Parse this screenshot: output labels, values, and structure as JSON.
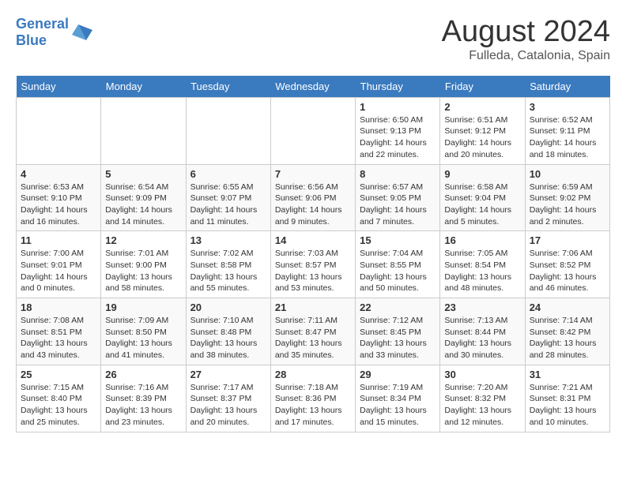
{
  "logo": {
    "line1": "General",
    "line2": "Blue"
  },
  "title": "August 2024",
  "subtitle": "Fulleda, Catalonia, Spain",
  "weekdays": [
    "Sunday",
    "Monday",
    "Tuesday",
    "Wednesday",
    "Thursday",
    "Friday",
    "Saturday"
  ],
  "weeks": [
    [
      {
        "day": "",
        "info": ""
      },
      {
        "day": "",
        "info": ""
      },
      {
        "day": "",
        "info": ""
      },
      {
        "day": "",
        "info": ""
      },
      {
        "day": "1",
        "info": "Sunrise: 6:50 AM\nSunset: 9:13 PM\nDaylight: 14 hours\nand 22 minutes."
      },
      {
        "day": "2",
        "info": "Sunrise: 6:51 AM\nSunset: 9:12 PM\nDaylight: 14 hours\nand 20 minutes."
      },
      {
        "day": "3",
        "info": "Sunrise: 6:52 AM\nSunset: 9:11 PM\nDaylight: 14 hours\nand 18 minutes."
      }
    ],
    [
      {
        "day": "4",
        "info": "Sunrise: 6:53 AM\nSunset: 9:10 PM\nDaylight: 14 hours\nand 16 minutes."
      },
      {
        "day": "5",
        "info": "Sunrise: 6:54 AM\nSunset: 9:09 PM\nDaylight: 14 hours\nand 14 minutes."
      },
      {
        "day": "6",
        "info": "Sunrise: 6:55 AM\nSunset: 9:07 PM\nDaylight: 14 hours\nand 11 minutes."
      },
      {
        "day": "7",
        "info": "Sunrise: 6:56 AM\nSunset: 9:06 PM\nDaylight: 14 hours\nand 9 minutes."
      },
      {
        "day": "8",
        "info": "Sunrise: 6:57 AM\nSunset: 9:05 PM\nDaylight: 14 hours\nand 7 minutes."
      },
      {
        "day": "9",
        "info": "Sunrise: 6:58 AM\nSunset: 9:04 PM\nDaylight: 14 hours\nand 5 minutes."
      },
      {
        "day": "10",
        "info": "Sunrise: 6:59 AM\nSunset: 9:02 PM\nDaylight: 14 hours\nand 2 minutes."
      }
    ],
    [
      {
        "day": "11",
        "info": "Sunrise: 7:00 AM\nSunset: 9:01 PM\nDaylight: 14 hours\nand 0 minutes."
      },
      {
        "day": "12",
        "info": "Sunrise: 7:01 AM\nSunset: 9:00 PM\nDaylight: 13 hours\nand 58 minutes."
      },
      {
        "day": "13",
        "info": "Sunrise: 7:02 AM\nSunset: 8:58 PM\nDaylight: 13 hours\nand 55 minutes."
      },
      {
        "day": "14",
        "info": "Sunrise: 7:03 AM\nSunset: 8:57 PM\nDaylight: 13 hours\nand 53 minutes."
      },
      {
        "day": "15",
        "info": "Sunrise: 7:04 AM\nSunset: 8:55 PM\nDaylight: 13 hours\nand 50 minutes."
      },
      {
        "day": "16",
        "info": "Sunrise: 7:05 AM\nSunset: 8:54 PM\nDaylight: 13 hours\nand 48 minutes."
      },
      {
        "day": "17",
        "info": "Sunrise: 7:06 AM\nSunset: 8:52 PM\nDaylight: 13 hours\nand 46 minutes."
      }
    ],
    [
      {
        "day": "18",
        "info": "Sunrise: 7:08 AM\nSunset: 8:51 PM\nDaylight: 13 hours\nand 43 minutes."
      },
      {
        "day": "19",
        "info": "Sunrise: 7:09 AM\nSunset: 8:50 PM\nDaylight: 13 hours\nand 41 minutes."
      },
      {
        "day": "20",
        "info": "Sunrise: 7:10 AM\nSunset: 8:48 PM\nDaylight: 13 hours\nand 38 minutes."
      },
      {
        "day": "21",
        "info": "Sunrise: 7:11 AM\nSunset: 8:47 PM\nDaylight: 13 hours\nand 35 minutes."
      },
      {
        "day": "22",
        "info": "Sunrise: 7:12 AM\nSunset: 8:45 PM\nDaylight: 13 hours\nand 33 minutes."
      },
      {
        "day": "23",
        "info": "Sunrise: 7:13 AM\nSunset: 8:44 PM\nDaylight: 13 hours\nand 30 minutes."
      },
      {
        "day": "24",
        "info": "Sunrise: 7:14 AM\nSunset: 8:42 PM\nDaylight: 13 hours\nand 28 minutes."
      }
    ],
    [
      {
        "day": "25",
        "info": "Sunrise: 7:15 AM\nSunset: 8:40 PM\nDaylight: 13 hours\nand 25 minutes."
      },
      {
        "day": "26",
        "info": "Sunrise: 7:16 AM\nSunset: 8:39 PM\nDaylight: 13 hours\nand 23 minutes."
      },
      {
        "day": "27",
        "info": "Sunrise: 7:17 AM\nSunset: 8:37 PM\nDaylight: 13 hours\nand 20 minutes."
      },
      {
        "day": "28",
        "info": "Sunrise: 7:18 AM\nSunset: 8:36 PM\nDaylight: 13 hours\nand 17 minutes."
      },
      {
        "day": "29",
        "info": "Sunrise: 7:19 AM\nSunset: 8:34 PM\nDaylight: 13 hours\nand 15 minutes."
      },
      {
        "day": "30",
        "info": "Sunrise: 7:20 AM\nSunset: 8:32 PM\nDaylight: 13 hours\nand 12 minutes."
      },
      {
        "day": "31",
        "info": "Sunrise: 7:21 AM\nSunset: 8:31 PM\nDaylight: 13 hours\nand 10 minutes."
      }
    ]
  ]
}
